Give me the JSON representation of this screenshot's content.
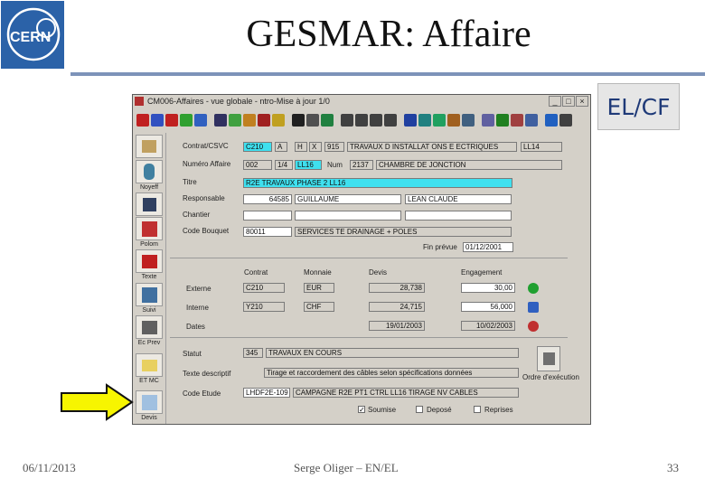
{
  "slide": {
    "title": "GESMAR: Affaire",
    "tag": "EL/CF",
    "footer_date": "06/11/2013",
    "footer_author": "Serge Oliger – EN/EL",
    "page_number": "33",
    "logo_text": "CERN"
  },
  "window": {
    "title": "CM006-Affaires - vue globale - ntro-Mise à jour 1/0",
    "min_label": "_",
    "max_label": "□",
    "close_label": "×"
  },
  "sidebar": {
    "labels": [
      "Noyeff",
      "Polom",
      "Texte",
      "Suivi",
      "Ec Prev",
      "ET MC",
      "Devis"
    ]
  },
  "form": {
    "contrat_label": "Contrat/CSVC",
    "contrat_code": "C210",
    "contrat_a": "A",
    "contrat_h": "H",
    "contrat_x": "X",
    "contrat_num": "915",
    "contrat_desc": "TRAVAUX D INSTALLAT ONS E ECTRIQUES",
    "contrat_extra": "LL14",
    "numero_label": "Numéro Affaire",
    "numero_code": "002",
    "numero_mid": "1/4",
    "numero_cyan": "LL16",
    "numero_num_label": "Num",
    "numero_num": "2137",
    "numero_desc": "CHAMBRE DE JONCTION",
    "titre_label": "Titre",
    "titre_value": "R2E TRAVAUX PHASE 2 LL16",
    "responsable_label": "Responsable",
    "responsable_id": "64585",
    "responsable_name": "GUILLAUME",
    "responsable_first": "LEAN CLAUDE",
    "chantier_label": "Chantier",
    "code_budget_label": "Code Bouquet",
    "code_budget_value": "80011",
    "code_budget_desc": "SERVICES TE DRAINAGE + POLES",
    "fin_prevue_label": "Fin prévue",
    "fin_prevue_value": "01/12/2001",
    "col_contrat": "Contrat",
    "col_monnaie": "Monnaie",
    "col_devis": "Devis",
    "col_engagement": "Engagement",
    "externe_label": "Externe",
    "externe_contrat": "C210",
    "externe_monnaie": "EUR",
    "externe_devis": "28,738",
    "externe_engagement": "30,00",
    "interne_label": "Interne",
    "interne_contrat": "Y210",
    "interne_monnaie": "CHF",
    "interne_devis": "24,715",
    "interne_engagement": "56,000",
    "dates_label": "Dates",
    "dates_devis": "19/01/2003",
    "dates_engagement": "10/02/2003",
    "statut_label": "Statut",
    "statut_code": "345",
    "statut_value": "TRAVAUX EN COURS",
    "texte_label": "Texte descriptif",
    "texte_value": "Tirage et raccordement des câbles selon spécifications données",
    "code_etude_label": "Code Etude",
    "code_etude_value": "LHDF2E-109",
    "code_etude_desc": "CAMPAGNE R2E PT1 CTRL LL16 TIRAGE NV CABLES",
    "ordre_label": "Ordre d'exécution",
    "soumise_label": "Soumise",
    "depose_label": "Deposé",
    "reprises_label": "Reprises",
    "soumise_checked": "✓"
  },
  "colors": {
    "highlight_field": "#3fe0ef",
    "arrow_fill": "#f7f500",
    "title_rule": "#7d93b9",
    "cern_blue": "#2b62a8"
  }
}
